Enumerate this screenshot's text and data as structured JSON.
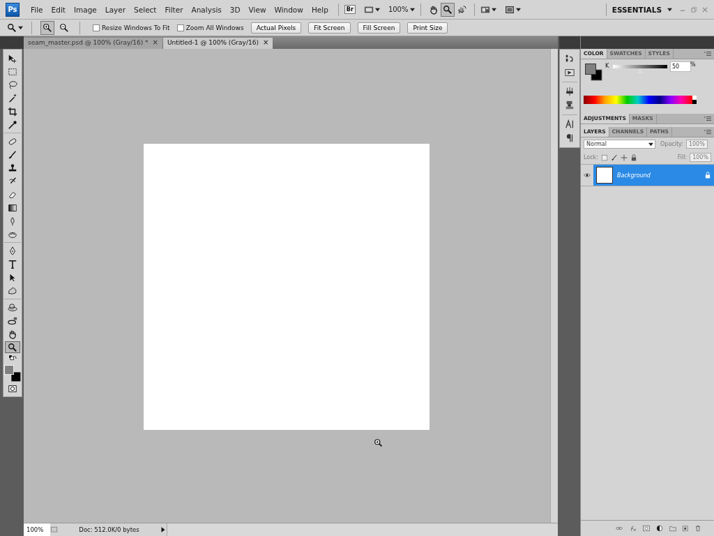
{
  "menu_bar": {
    "logo": "Ps",
    "menus": [
      "File",
      "Edit",
      "Image",
      "Layer",
      "Select",
      "Filter",
      "Analysis",
      "3D",
      "View",
      "Window",
      "Help"
    ],
    "bridge": "Br",
    "zoom": "100%",
    "view_tools": [
      {
        "selected": false
      },
      {
        "selected": true
      },
      {
        "selected": false
      }
    ],
    "workspace": "ESSENTIALS"
  },
  "options_bar": {
    "zoom_modes": [
      {
        "selected": true
      },
      {
        "selected": false
      }
    ],
    "checkboxes": [
      {
        "label": "Resize Windows To Fit",
        "checked": false
      },
      {
        "label": "Zoom All Windows",
        "checked": false
      }
    ],
    "buttons": [
      "Actual Pixels",
      "Fit Screen",
      "Fill Screen",
      "Print Size"
    ]
  },
  "doc_tabs": [
    {
      "label": "seam_master.psd @ 100% (Gray/16) *",
      "close": "×",
      "selected": false
    },
    {
      "label": "Untitled-1 @ 100% (Gray/16)",
      "close": "×",
      "selected": true
    }
  ],
  "tools": [
    {
      "selected": false
    },
    {
      "selected": false
    },
    {
      "selected": false
    },
    {
      "selected": false
    },
    {
      "selected": false
    },
    {
      "selected": false
    },
    {
      "selected": false
    },
    {
      "selected": false
    },
    {
      "selected": false
    },
    {
      "selected": false
    },
    {
      "selected": false
    },
    {
      "selected": false
    },
    {
      "selected": false
    },
    {
      "selected": false
    },
    {
      "selected": false
    },
    {
      "selected": false
    },
    {
      "selected": false
    },
    {
      "selected": false
    },
    {
      "selected": false
    },
    {
      "selected": false
    },
    {
      "selected": false
    },
    {
      "selected": true
    }
  ],
  "status_bar": {
    "zoom": "100%",
    "doc_info": "Doc: 512.0K/0 bytes"
  },
  "color_panel": {
    "tabs": [
      {
        "label": "COLOR",
        "selected": true
      },
      {
        "label": "SWATCHES",
        "selected": false
      },
      {
        "label": "STYLES",
        "selected": false
      }
    ],
    "channel": "K",
    "level": 0.5,
    "value": "50",
    "unit": "%"
  },
  "adjustments_panel": {
    "tabs": [
      {
        "label": "ADJUSTMENTS",
        "selected": true
      },
      {
        "label": "MASKS",
        "selected": false
      }
    ]
  },
  "layers_panel": {
    "tabs": [
      {
        "label": "LAYERS",
        "selected": true
      },
      {
        "label": "CHANNELS",
        "selected": false
      },
      {
        "label": "PATHS",
        "selected": false
      }
    ],
    "blend_mode": "Normal",
    "opacity_label": "Opacity:",
    "opacity": "100%",
    "lock_label": "Lock:",
    "fill_label": "Fill:",
    "fill": "100%",
    "controls_disabled": true,
    "layers": [
      {
        "name": "Background",
        "selected": true,
        "visible": true,
        "locked": true
      }
    ]
  }
}
